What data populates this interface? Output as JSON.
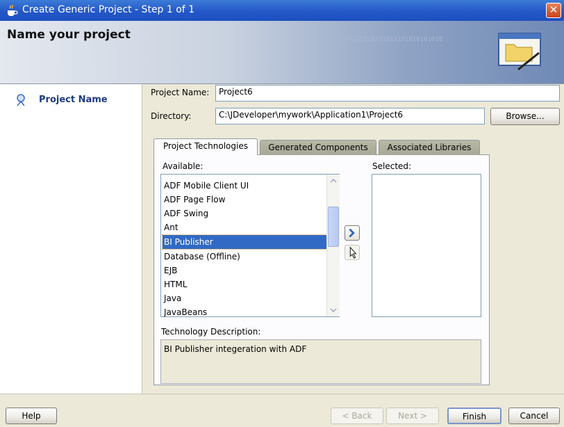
{
  "window": {
    "title": "Create Generic Project - Step 1 of 1",
    "close_glyph": "✕"
  },
  "header": {
    "title": "Name your project",
    "binary_text": "01010101010101010101010101010"
  },
  "sidebar": {
    "items": [
      {
        "label": "Project Name"
      }
    ]
  },
  "form": {
    "project_name_label": "Project Name:",
    "project_name_value": "Project6",
    "directory_label": "Directory:",
    "directory_value": "C:\\JDeveloper\\mywork\\Application1\\Project6",
    "browse_label": "Browse..."
  },
  "tabs": [
    {
      "label": "Project Technologies",
      "active": true
    },
    {
      "label": "Generated Components",
      "active": false
    },
    {
      "label": "Associated Libraries",
      "active": false
    }
  ],
  "technologies": {
    "available_label": "Available:",
    "selected_label": "Selected:",
    "available_items": [
      "ADF Mobile Client UI",
      "ADF Page Flow",
      "ADF Swing",
      "Ant",
      "BI Publisher",
      "Database (Offline)",
      "EJB",
      "HTML",
      "Java",
      "JavaBeans"
    ],
    "selected_item": "BI Publisher",
    "selected_items": [],
    "description_label": "Technology Description:",
    "description_text": "BI Publisher integeration with ADF"
  },
  "footer": {
    "help_label": "Help",
    "back_label": "< Back",
    "next_label": "Next >",
    "finish_label": "Finish",
    "cancel_label": "Cancel"
  },
  "colors": {
    "title_bar": "#2458c8",
    "selection": "#316ac5",
    "sidebar_link": "#1b3b82"
  }
}
